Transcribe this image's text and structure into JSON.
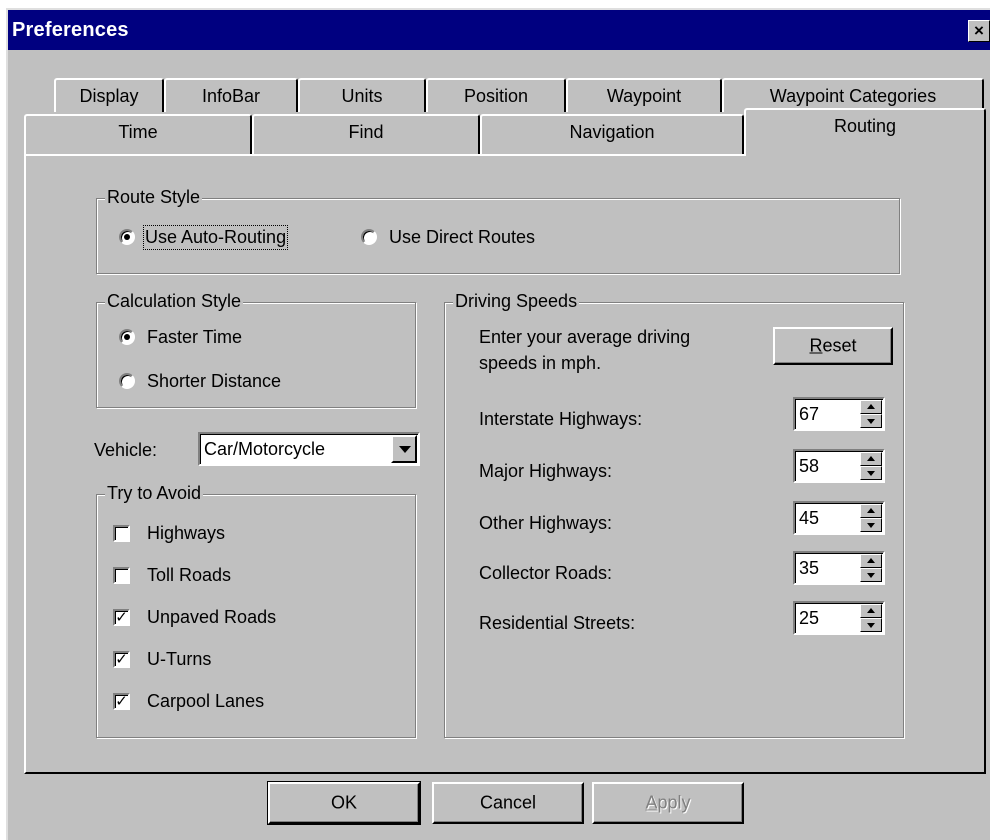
{
  "window": {
    "title": "Preferences",
    "close_glyph": "×"
  },
  "tabs_back": [
    "Display",
    "InfoBar",
    "Units",
    "Position",
    "Waypoint",
    "Waypoint Categories"
  ],
  "tabs_front": [
    "Time",
    "Find",
    "Navigation",
    "Routing"
  ],
  "active_tab": "Routing",
  "route_style": {
    "label": "Route Style",
    "options": [
      "Use Auto-Routing",
      "Use Direct Routes"
    ],
    "selected": "Use Auto-Routing"
  },
  "calculation_style": {
    "label": "Calculation Style",
    "options": [
      "Faster Time",
      "Shorter Distance"
    ],
    "selected": "Faster Time"
  },
  "vehicle": {
    "label": "Vehicle:",
    "value": "Car/Motorcycle"
  },
  "try_to_avoid": {
    "label": "Try to Avoid",
    "items": [
      {
        "label": "Highways",
        "checked": false
      },
      {
        "label": "Toll Roads",
        "checked": false
      },
      {
        "label": "Unpaved Roads",
        "checked": true
      },
      {
        "label": "U-Turns",
        "checked": true
      },
      {
        "label": "Carpool Lanes",
        "checked": true
      }
    ],
    "check_glyph": "✓"
  },
  "driving_speeds": {
    "label": "Driving Speeds",
    "instructions_line1": "Enter your average driving",
    "instructions_line2": "speeds in mph.",
    "reset_mnemonic": "R",
    "reset_rest": "eset",
    "rows": [
      {
        "label": "Interstate Highways:",
        "value": "67"
      },
      {
        "label": "Major Highways:",
        "value": "58"
      },
      {
        "label": "Other Highways:",
        "value": "45"
      },
      {
        "label": "Collector Roads:",
        "value": "35"
      },
      {
        "label": "Residential Streets:",
        "value": "25"
      }
    ]
  },
  "buttons": {
    "ok": "OK",
    "cancel": "Cancel",
    "apply_mnemonic": "A",
    "apply_rest": "pply"
  },
  "colors": {
    "title_bar": "#000080",
    "face": "#c0c0c0",
    "window_bg": "#ffffff"
  },
  "icons": [
    "close-icon",
    "dropdown-arrow-icon",
    "spin-up-icon",
    "spin-down-icon",
    "check-icon"
  ]
}
